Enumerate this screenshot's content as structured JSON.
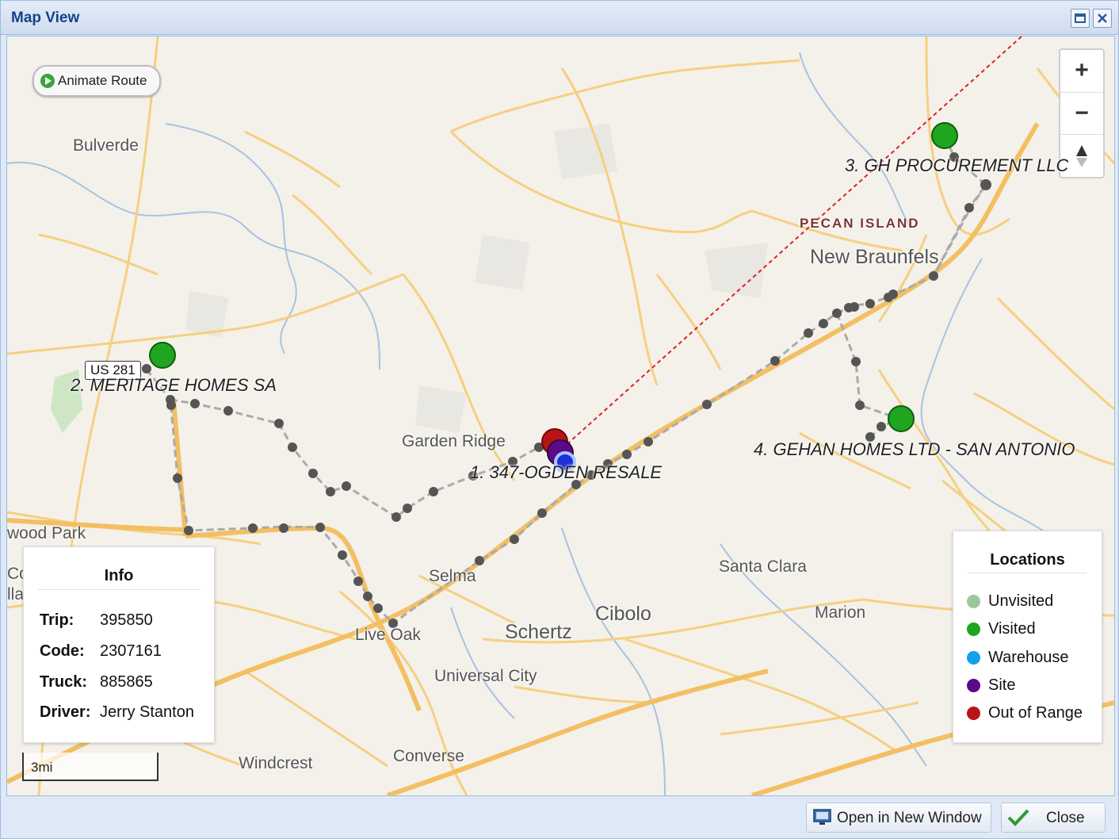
{
  "window": {
    "title": "Map View"
  },
  "controls": {
    "animate_route": "Animate Route"
  },
  "map": {
    "places": {
      "bulverde": "Bulverde",
      "pecan_island": "PECAN ISLAND",
      "new_braunfels": "New Braunfels",
      "garden_ridge": "Garden Ridge",
      "wood_park": "wood Park",
      "selma": "Selma",
      "santa_clara": "Santa Clara",
      "cibolo": "Cibolo",
      "schertz": "Schertz",
      "marion": "Marion",
      "live_oak": "Live Oak",
      "universal_city": "Universal City",
      "windcrest": "Windcrest",
      "converse": "Converse",
      "edge_co": "Co",
      "edge_lla": "lla"
    },
    "highway_shield": "US 281",
    "stops": [
      {
        "label": "1. 347-OGDEN RESALE",
        "status": "Out of Range"
      },
      {
        "label": "2. MERITAGE HOMES SA",
        "status": "Visited"
      },
      {
        "label": "3. GH PROCUREMENT LLC",
        "status": "Visited"
      },
      {
        "label": "4. GEHAN HOMES LTD - SAN ANTONIO",
        "status": "Visited"
      }
    ],
    "scale": "3mi"
  },
  "info": {
    "title": "Info",
    "trip_label": "Trip:",
    "trip": "395850",
    "code_label": "Code:",
    "code": "2307161",
    "truck_label": "Truck:",
    "truck": "885865",
    "driver_label": "Driver:",
    "driver": "Jerry Stanton"
  },
  "legend": {
    "title": "Locations",
    "items": [
      {
        "label": "Unvisited",
        "color": "#9cc79c"
      },
      {
        "label": "Visited",
        "color": "#1fa51f"
      },
      {
        "label": "Warehouse",
        "color": "#14a0e8"
      },
      {
        "label": "Site",
        "color": "#5b0a8a"
      },
      {
        "label": "Out of Range",
        "color": "#b81414"
      }
    ]
  },
  "footer": {
    "open_new_window": "Open in New Window",
    "close": "Close"
  },
  "colors": {
    "title_text": "#15428b",
    "route_dots": "#555555",
    "out_of_range_line": "#e02020",
    "road": "#f6cf80"
  }
}
